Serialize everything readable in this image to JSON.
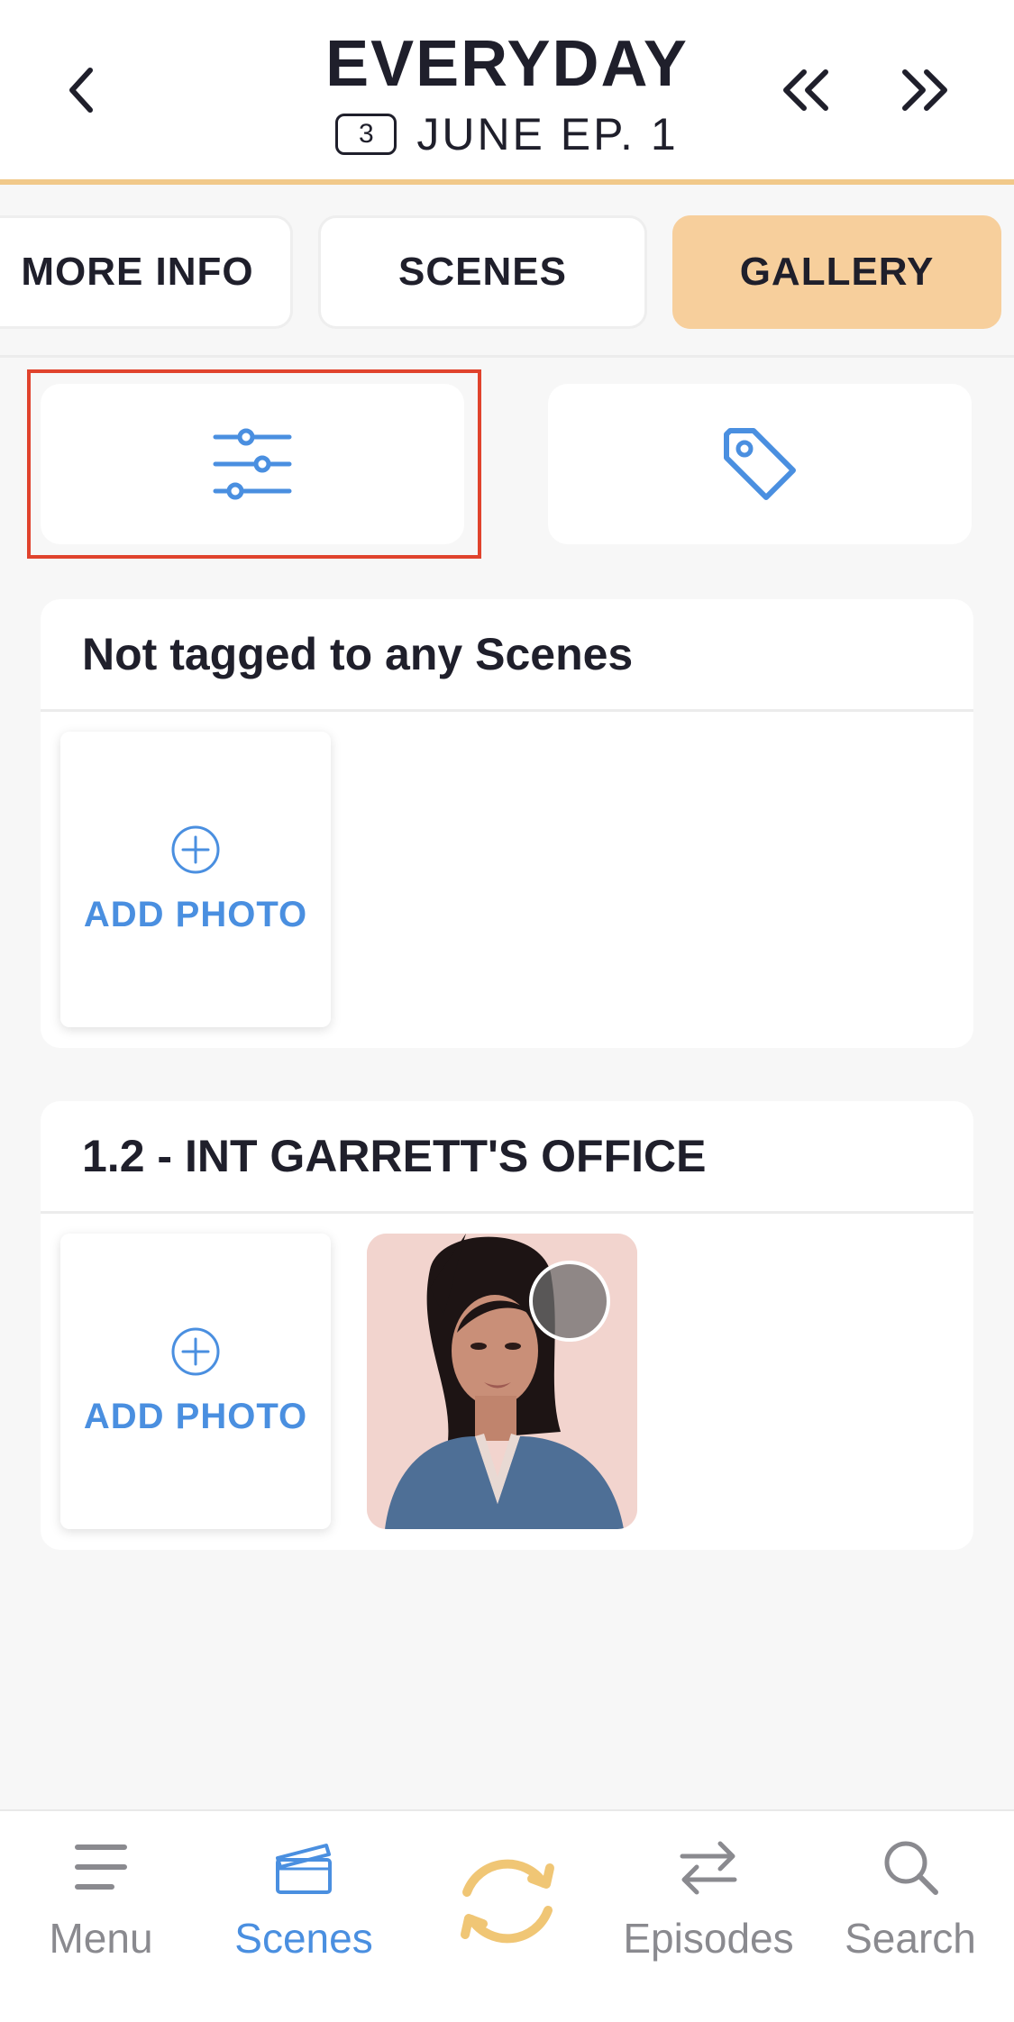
{
  "header": {
    "title": "EVERYDAY",
    "day_badge": "3",
    "subtitle": "JUNE  EP. 1"
  },
  "tabs": [
    {
      "label": "MORE INFO",
      "active": false
    },
    {
      "label": "SCENES",
      "active": false
    },
    {
      "label": "GALLERY",
      "active": true
    }
  ],
  "tools": {
    "filter_icon": "sliders-icon",
    "tag_icon": "tag-icon"
  },
  "sections": [
    {
      "title": "Not tagged to any Scenes",
      "add_label": "ADD PHOTO",
      "photos": 0
    },
    {
      "title": "1.2 - INT GARRETT'S OFFICE",
      "add_label": "ADD PHOTO",
      "photos": 1
    }
  ],
  "bottom_nav": {
    "menu": "Menu",
    "scenes": "Scenes",
    "episodes": "Episodes",
    "search": "Search"
  },
  "colors": {
    "accent": "#4a8fe0",
    "gallery_tab": "#f7cf9c",
    "header_border": "#f1c98a",
    "sync": "#f0c675",
    "highlight": "#e0432d"
  }
}
